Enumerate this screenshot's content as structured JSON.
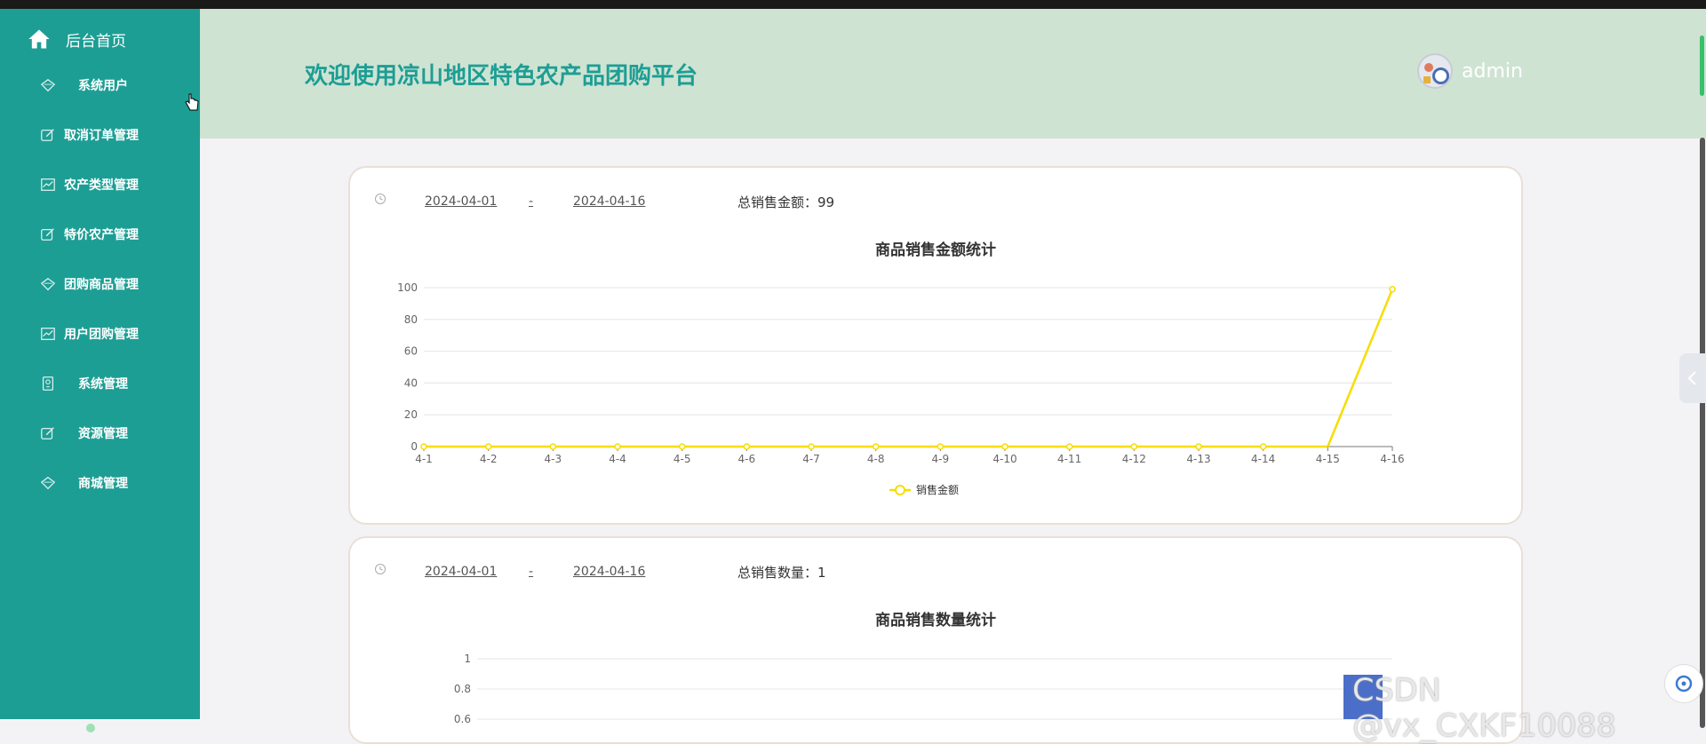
{
  "sidebar": {
    "home_label": "后台首页",
    "items": [
      {
        "label": "系统用户",
        "icon": "diamond-icon"
      },
      {
        "label": "取消订单管理",
        "icon": "edit-icon"
      },
      {
        "label": "农产类型管理",
        "icon": "chart-icon"
      },
      {
        "label": "特价农产管理",
        "icon": "edit-icon"
      },
      {
        "label": "团购商品管理",
        "icon": "diamond-icon"
      },
      {
        "label": "用户团购管理",
        "icon": "chart-icon"
      },
      {
        "label": "系统管理",
        "icon": "certificate-icon"
      },
      {
        "label": "资源管理",
        "icon": "edit-icon"
      },
      {
        "label": "商城管理",
        "icon": "diamond-icon"
      }
    ]
  },
  "header": {
    "title": "欢迎使用凉山地区特色农产品团购平台",
    "username": "admin"
  },
  "card1": {
    "start_date": "2024-04-01",
    "separator": "-",
    "end_date": "2024-04-16",
    "total_label": "总销售金额：",
    "total_value": "99"
  },
  "card2": {
    "start_date": "2024-04-01",
    "separator": "-",
    "end_date": "2024-04-16",
    "total_label": "总销售数量：",
    "total_value": "1"
  },
  "watermark": "CSDN @vx_CXKF10088",
  "colors": {
    "sidebar": "#1d9e94",
    "header": "#cfe3d3",
    "series_line": "#f7dd00"
  },
  "chart_data": [
    {
      "type": "line",
      "title": "商品销售金额统计",
      "x": [
        "4-1",
        "4-2",
        "4-3",
        "4-4",
        "4-5",
        "4-6",
        "4-7",
        "4-8",
        "4-9",
        "4-10",
        "4-11",
        "4-12",
        "4-13",
        "4-14",
        "4-15",
        "4-16"
      ],
      "series": [
        {
          "name": "销售金额",
          "values": [
            0,
            0,
            0,
            0,
            0,
            0,
            0,
            0,
            0,
            0,
            0,
            0,
            0,
            0,
            0,
            99
          ]
        }
      ],
      "ylim": [
        0,
        100
      ],
      "yticks": [
        0,
        20,
        40,
        60,
        80,
        100
      ],
      "grid": true,
      "legend": "bottom-center"
    },
    {
      "type": "line",
      "title": "商品销售数量统计",
      "ylim": [
        0,
        1
      ],
      "yticks": [
        0.6,
        0.8,
        1
      ],
      "grid": true
    }
  ]
}
